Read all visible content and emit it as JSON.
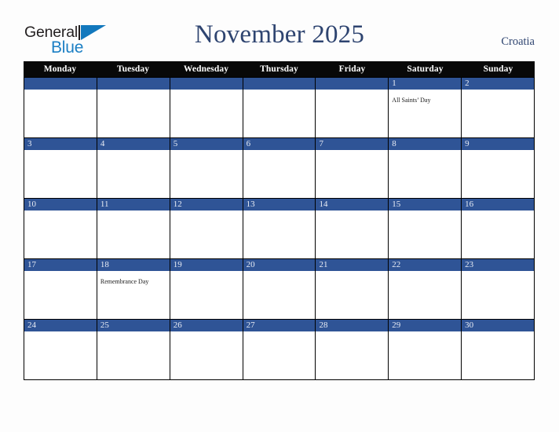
{
  "brand": {
    "name_part1": "General",
    "name_part2": "Blue",
    "mark": "triangle-logo"
  },
  "header": {
    "title": "November 2025",
    "country": "Croatia"
  },
  "colors": {
    "date_bar_blue": "#2f5496",
    "weekday_header": "#080808",
    "title_navy": "#2e4470",
    "logo_blue": "#1278bd",
    "page_background": "#fdfdfd"
  },
  "weekdays": [
    "Monday",
    "Tuesday",
    "Wednesday",
    "Thursday",
    "Friday",
    "Saturday",
    "Sunday"
  ],
  "weeks": [
    [
      {
        "date": "",
        "event": ""
      },
      {
        "date": "",
        "event": ""
      },
      {
        "date": "",
        "event": ""
      },
      {
        "date": "",
        "event": ""
      },
      {
        "date": "",
        "event": ""
      },
      {
        "date": "1",
        "event": "All Saints’ Day"
      },
      {
        "date": "2",
        "event": ""
      }
    ],
    [
      {
        "date": "3",
        "event": ""
      },
      {
        "date": "4",
        "event": ""
      },
      {
        "date": "5",
        "event": ""
      },
      {
        "date": "6",
        "event": ""
      },
      {
        "date": "7",
        "event": ""
      },
      {
        "date": "8",
        "event": ""
      },
      {
        "date": "9",
        "event": ""
      }
    ],
    [
      {
        "date": "10",
        "event": ""
      },
      {
        "date": "11",
        "event": ""
      },
      {
        "date": "12",
        "event": ""
      },
      {
        "date": "13",
        "event": ""
      },
      {
        "date": "14",
        "event": ""
      },
      {
        "date": "15",
        "event": ""
      },
      {
        "date": "16",
        "event": ""
      }
    ],
    [
      {
        "date": "17",
        "event": ""
      },
      {
        "date": "18",
        "event": "Remembrance Day"
      },
      {
        "date": "19",
        "event": ""
      },
      {
        "date": "20",
        "event": ""
      },
      {
        "date": "21",
        "event": ""
      },
      {
        "date": "22",
        "event": ""
      },
      {
        "date": "23",
        "event": ""
      }
    ],
    [
      {
        "date": "24",
        "event": ""
      },
      {
        "date": "25",
        "event": ""
      },
      {
        "date": "26",
        "event": ""
      },
      {
        "date": "27",
        "event": ""
      },
      {
        "date": "28",
        "event": ""
      },
      {
        "date": "29",
        "event": ""
      },
      {
        "date": "30",
        "event": ""
      }
    ]
  ]
}
